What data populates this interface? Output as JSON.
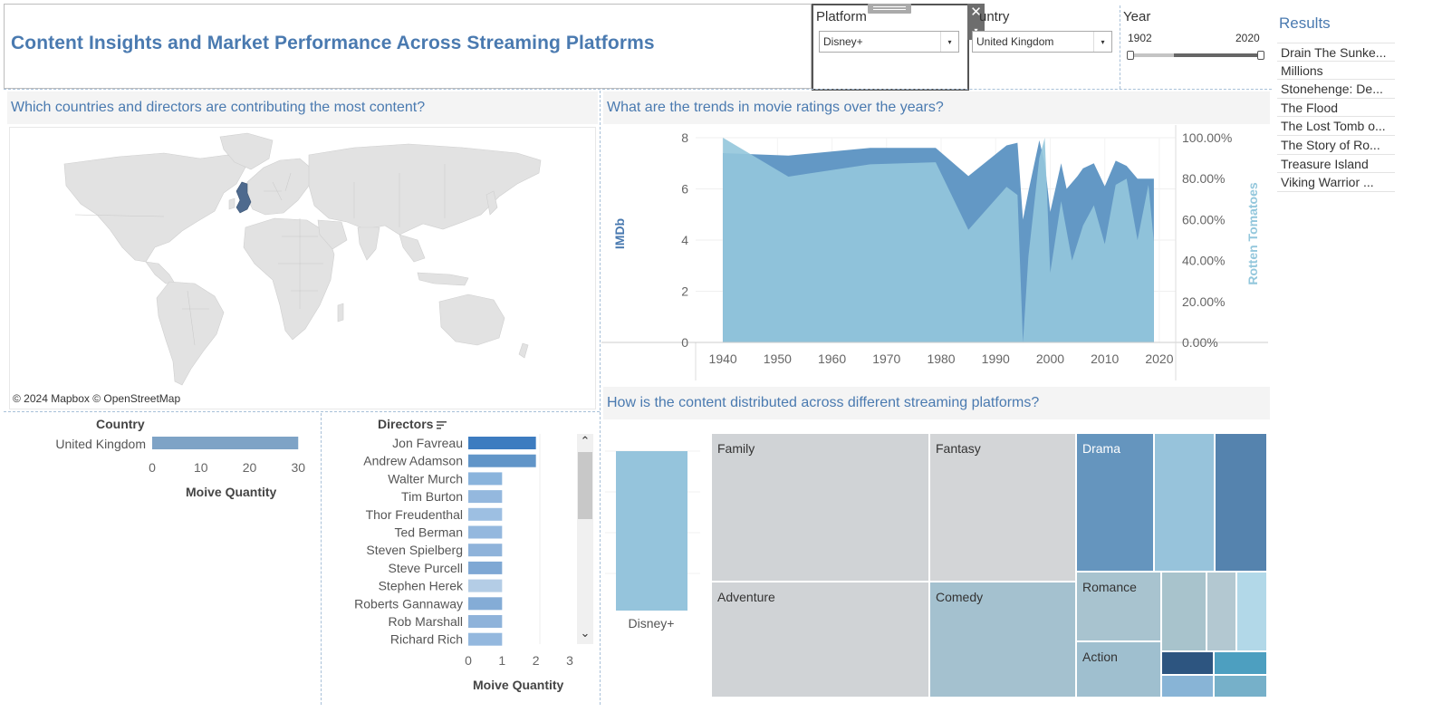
{
  "dashboard": {
    "title": "Content Insights and Market Performance Across Streaming Platforms"
  },
  "filters": {
    "platform": {
      "label": "Platform",
      "value": "Disney+"
    },
    "country": {
      "label": "untry",
      "value": "United Kingdom"
    },
    "year": {
      "label": "Year",
      "min_label": "1902",
      "max_label": "2020"
    },
    "close_glyph": "✕",
    "collapse_glyph": "▾",
    "dropdown_glyph": "▾"
  },
  "results": {
    "title": "Results",
    "items": [
      "Drain The Sunke...",
      "Millions",
      "Stonehenge: De...",
      "The Flood",
      "The Lost Tomb o...",
      "The Story of Ro...",
      "Treasure Island",
      "Viking Warrior ..."
    ]
  },
  "sections": {
    "map_question": "Which countries and directors are contributing the most content?",
    "ratings_question": "What are the trends in movie ratings over the years?",
    "distribution_question": "How is the content distributed across different streaming platforms?"
  },
  "map": {
    "credit": "© 2024 Mapbox © OpenStreetMap",
    "highlight_country": "United Kingdom",
    "highlight_color": "#4e6a8e",
    "land_color": "#e0e0e0"
  },
  "country_chart": {
    "header": "Country",
    "xlabel": "Moive Quantity",
    "ticks": [
      "0",
      "10",
      "20",
      "30"
    ]
  },
  "directors_chart": {
    "header": "Directors",
    "sort_icon": "sort-icon",
    "xlabel": "Moive Quantity",
    "ticks": [
      "0",
      "1",
      "2",
      "3"
    ],
    "scroll_up": "⌃",
    "scroll_down": "⌄"
  },
  "ratings_chart": {
    "left_axis_title": "IMDb",
    "right_axis_title": "Rotten Tomatoes",
    "left_ticks": [
      "8",
      "6",
      "4",
      "2",
      "0"
    ],
    "right_ticks": [
      "100.00%",
      "80.00%",
      "60.00%",
      "40.00%",
      "20.00%",
      "0.00%"
    ],
    "x_ticks": [
      "1940",
      "1950",
      "1960",
      "1970",
      "1980",
      "1990",
      "2000",
      "2010",
      "2020"
    ]
  },
  "platform_bar": {
    "label": "Disney+",
    "color": "#95c4dc"
  },
  "treemap": {
    "labels": [
      "Family",
      "Fantasy",
      "Drama",
      "Adventure",
      "Comedy",
      "Romance",
      "Action"
    ]
  },
  "chart_data": [
    {
      "type": "bar",
      "categories": [
        "United Kingdom"
      ],
      "values": [
        30
      ],
      "xlabel": "Moive Quantity",
      "xlim": [
        0,
        32
      ],
      "color": "#7ea3c6"
    },
    {
      "type": "bar",
      "categories": [
        "Jon Favreau",
        "Andrew Adamson",
        "Walter Murch",
        "Tim Burton",
        "Thor Freudenthal",
        "Ted Berman",
        "Steven Spielberg",
        "Steve Purcell",
        "Stephen Herek",
        "Roberts Gannaway",
        "Rob Marshall",
        "Richard Rich"
      ],
      "values": [
        2,
        2,
        1,
        1,
        1,
        1,
        1,
        1,
        1,
        1,
        1,
        1
      ],
      "xlabel": "Moive Quantity",
      "xlim": [
        0,
        3
      ],
      "colors": [
        "#3d7cc0",
        "#6195c8",
        "#8ab4dc",
        "#94b8de",
        "#9dbfe2",
        "#94b8de",
        "#8fb3da",
        "#7fa8d4",
        "#b4cde6",
        "#84acd6",
        "#8fb3da",
        "#94b8de"
      ]
    },
    {
      "type": "area",
      "x_range": [
        1935,
        2023
      ],
      "grid": true,
      "series": [
        {
          "name": "IMDb",
          "axis": "left",
          "ylim": [
            0,
            8
          ],
          "color": "#5b92c2",
          "points": [
            [
              1940,
              7.4
            ],
            [
              1952,
              7.3
            ],
            [
              1967,
              7.6
            ],
            [
              1979,
              7.6
            ],
            [
              1985,
              6.5
            ],
            [
              1992,
              7.7
            ],
            [
              1994,
              7.8
            ],
            [
              1995,
              4.8
            ],
            [
              1996,
              5.9
            ],
            [
              1998,
              7.9
            ],
            [
              1999,
              7.0
            ],
            [
              2000,
              5.1
            ],
            [
              2002,
              7.0
            ],
            [
              2003,
              6.0
            ],
            [
              2005,
              6.5
            ],
            [
              2006,
              6.8
            ],
            [
              2008,
              7.0
            ],
            [
              2010,
              6.1
            ],
            [
              2012,
              7.1
            ],
            [
              2014,
              6.9
            ],
            [
              2016,
              6.4
            ],
            [
              2019,
              6.4
            ]
          ]
        },
        {
          "name": "Rotten Tomatoes",
          "axis": "right",
          "ylim": [
            0,
            100
          ],
          "color": "#93c7dc",
          "points": [
            [
              1940,
              100
            ],
            [
              1952,
              81
            ],
            [
              1967,
              87
            ],
            [
              1979,
              88
            ],
            [
              1985,
              55
            ],
            [
              1992,
              76
            ],
            [
              1994,
              72
            ],
            [
              1995,
              0
            ],
            [
              1996,
              42
            ],
            [
              1998,
              90
            ],
            [
              1999,
              100
            ],
            [
              2000,
              34
            ],
            [
              2002,
              69
            ],
            [
              2004,
              40
            ],
            [
              2006,
              57
            ],
            [
              2008,
              67
            ],
            [
              2010,
              48
            ],
            [
              2012,
              77
            ],
            [
              2014,
              80
            ],
            [
              2016,
              50
            ],
            [
              2018,
              77
            ],
            [
              2019,
              49
            ]
          ]
        }
      ]
    },
    {
      "type": "bar",
      "categories": [
        "Disney+"
      ],
      "values": [
        1
      ],
      "color": "#95c4dc"
    }
  ]
}
